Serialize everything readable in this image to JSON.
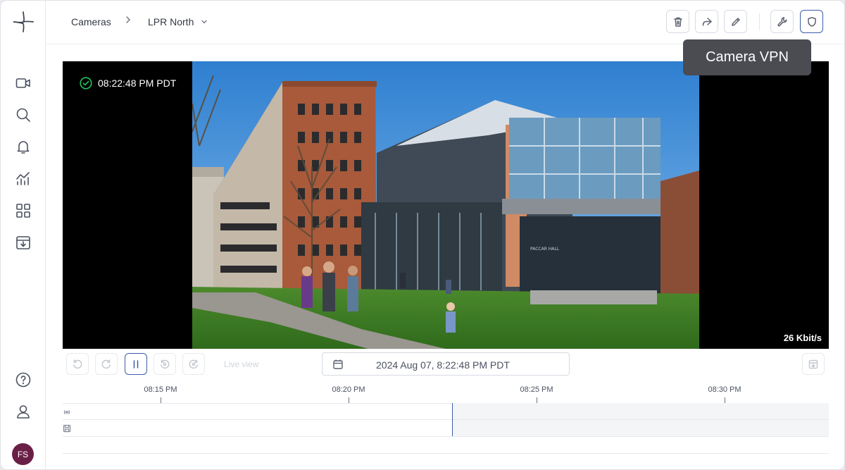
{
  "breadcrumb": {
    "root": "Cameras",
    "current": "LPR North"
  },
  "toolbar": {
    "tooltip": "Camera VPN"
  },
  "video": {
    "timestamp": "08:22:48 PM PDT",
    "bitrate": "26 Kbit/s",
    "building_sign": "PACCAR HALL"
  },
  "controls": {
    "live_view_label": "Live view",
    "datetime": "2024 Aug 07, 8:22:48 PM PDT"
  },
  "timeline": {
    "ticks": [
      "08:15 PM",
      "08:20 PM",
      "08:25 PM",
      "08:30 PM"
    ]
  },
  "user": {
    "initials": "FS"
  },
  "colors": {
    "accent": "#3d5ea8",
    "avatar": "#6a1f47",
    "status_ok": "#22c55e",
    "tooltip_bg": "#4a4c52"
  },
  "icons": {
    "sidebar": [
      "camera-icon",
      "search-icon",
      "bell-icon",
      "analytics-icon",
      "grid-icon",
      "archive-icon",
      "help-icon",
      "user-icon"
    ],
    "toolbar": [
      "trash-icon",
      "share-icon",
      "pencil-icon",
      "wrench-icon",
      "shield-icon"
    ]
  }
}
